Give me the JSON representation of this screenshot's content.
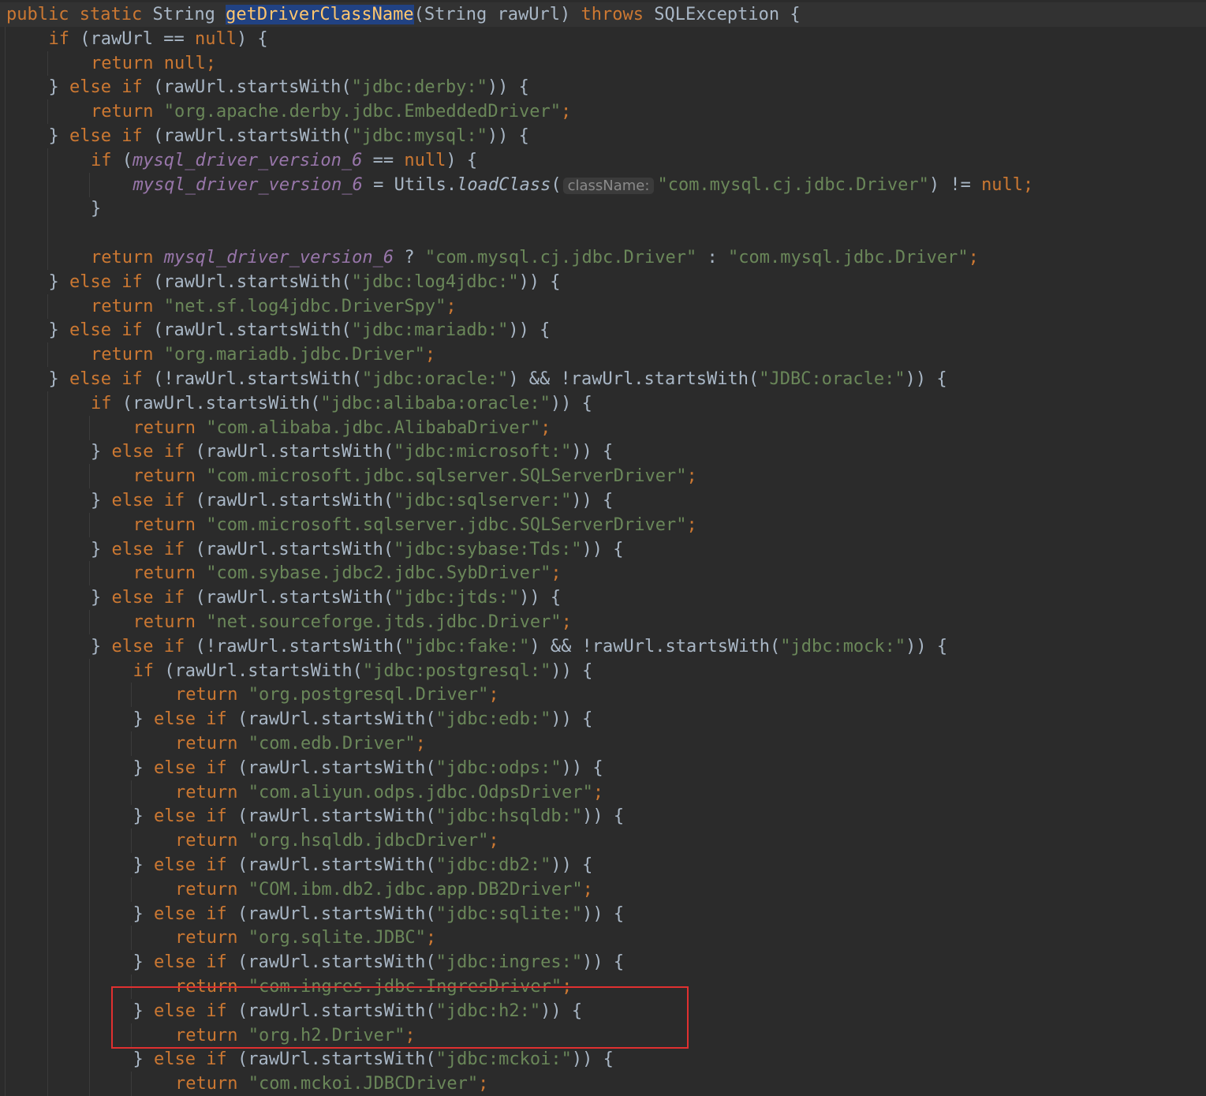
{
  "editor": {
    "method_name": "getDriverClassName",
    "colors": {
      "background": "#2b2b2b",
      "keyword": "#cc7832",
      "string": "#6a8759",
      "field": "#9876aa",
      "selection": "#214283",
      "highlight_box": "#e03030"
    },
    "lines": [
      [
        [
          "kw",
          "public static "
        ],
        [
          "p",
          "String "
        ],
        [
          "sel",
          "getDriverClassName"
        ],
        [
          "p",
          "(String rawUrl) "
        ],
        [
          "kw",
          "throws "
        ],
        [
          "p",
          "SQLException {"
        ]
      ],
      [
        [
          "kw",
          "if "
        ],
        [
          "p",
          "(rawUrl == "
        ],
        [
          "kw",
          "null"
        ],
        [
          "p",
          ") {"
        ]
      ],
      [
        [
          "kw",
          "return null;"
        ]
      ],
      [
        [
          "p",
          "} "
        ],
        [
          "kw",
          "else if "
        ],
        [
          "p",
          "(rawUrl.startsWith("
        ],
        [
          "str",
          "\"jdbc:derby:\""
        ],
        [
          "p",
          ")) {"
        ]
      ],
      [
        [
          "kw",
          "return "
        ],
        [
          "str",
          "\"org.apache.derby.jdbc.EmbeddedDriver\""
        ],
        [
          "kw",
          ";"
        ]
      ],
      [
        [
          "p",
          "} "
        ],
        [
          "kw",
          "else if "
        ],
        [
          "p",
          "(rawUrl.startsWith("
        ],
        [
          "str",
          "\"jdbc:mysql:\""
        ],
        [
          "p",
          ")) {"
        ]
      ],
      [
        [
          "kw",
          "if "
        ],
        [
          "p",
          "("
        ],
        [
          "fld",
          "mysql_driver_version_6"
        ],
        [
          "p",
          " == "
        ],
        [
          "kw",
          "null"
        ],
        [
          "p",
          ") {"
        ]
      ],
      [
        [
          "fld",
          "mysql_driver_version_6"
        ],
        [
          "p",
          " = Utils."
        ],
        [
          "smth",
          "loadClass"
        ],
        [
          "p",
          "("
        ],
        [
          "hint",
          "className:"
        ],
        [
          "str",
          "\"com.mysql.cj.jdbc.Driver\""
        ],
        [
          "p",
          ") != "
        ],
        [
          "kw",
          "null;"
        ]
      ],
      [
        [
          "p",
          "}"
        ]
      ],
      [],
      [
        [
          "kw",
          "return "
        ],
        [
          "fld",
          "mysql_driver_version_6"
        ],
        [
          "p",
          " ? "
        ],
        [
          "str",
          "\"com.mysql.cj.jdbc.Driver\""
        ],
        [
          "p",
          " : "
        ],
        [
          "str",
          "\"com.mysql.jdbc.Driver\""
        ],
        [
          "kw",
          ";"
        ]
      ],
      [
        [
          "p",
          "} "
        ],
        [
          "kw",
          "else if "
        ],
        [
          "p",
          "(rawUrl.startsWith("
        ],
        [
          "str",
          "\"jdbc:log4jdbc:\""
        ],
        [
          "p",
          ")) {"
        ]
      ],
      [
        [
          "kw",
          "return "
        ],
        [
          "str",
          "\"net.sf.log4jdbc.DriverSpy\""
        ],
        [
          "kw",
          ";"
        ]
      ],
      [
        [
          "p",
          "} "
        ],
        [
          "kw",
          "else if "
        ],
        [
          "p",
          "(rawUrl.startsWith("
        ],
        [
          "str",
          "\"jdbc:mariadb:\""
        ],
        [
          "p",
          ")) {"
        ]
      ],
      [
        [
          "kw",
          "return "
        ],
        [
          "str",
          "\"org.mariadb.jdbc.Driver\""
        ],
        [
          "kw",
          ";"
        ]
      ],
      [
        [
          "p",
          "} "
        ],
        [
          "kw",
          "else if "
        ],
        [
          "p",
          "(!rawUrl.startsWith("
        ],
        [
          "str",
          "\"jdbc:oracle:\""
        ],
        [
          "p",
          ") && !rawUrl.startsWith("
        ],
        [
          "str",
          "\"JDBC:oracle:\""
        ],
        [
          "p",
          ")) {"
        ]
      ],
      [
        [
          "kw",
          "if "
        ],
        [
          "p",
          "(rawUrl.startsWith("
        ],
        [
          "str",
          "\"jdbc:alibaba:oracle:\""
        ],
        [
          "p",
          ")) {"
        ]
      ],
      [
        [
          "kw",
          "return "
        ],
        [
          "str",
          "\"com.alibaba.jdbc.AlibabaDriver\""
        ],
        [
          "kw",
          ";"
        ]
      ],
      [
        [
          "p",
          "} "
        ],
        [
          "kw",
          "else if "
        ],
        [
          "p",
          "(rawUrl.startsWith("
        ],
        [
          "str",
          "\"jdbc:microsoft:\""
        ],
        [
          "p",
          ")) {"
        ]
      ],
      [
        [
          "kw",
          "return "
        ],
        [
          "str",
          "\"com.microsoft.jdbc.sqlserver.SQLServerDriver\""
        ],
        [
          "kw",
          ";"
        ]
      ],
      [
        [
          "p",
          "} "
        ],
        [
          "kw",
          "else if "
        ],
        [
          "p",
          "(rawUrl.startsWith("
        ],
        [
          "str",
          "\"jdbc:sqlserver:\""
        ],
        [
          "p",
          ")) {"
        ]
      ],
      [
        [
          "kw",
          "return "
        ],
        [
          "str",
          "\"com.microsoft.sqlserver.jdbc.SQLServerDriver\""
        ],
        [
          "kw",
          ";"
        ]
      ],
      [
        [
          "p",
          "} "
        ],
        [
          "kw",
          "else if "
        ],
        [
          "p",
          "(rawUrl.startsWith("
        ],
        [
          "str",
          "\"jdbc:sybase:Tds:\""
        ],
        [
          "p",
          ")) {"
        ]
      ],
      [
        [
          "kw",
          "return "
        ],
        [
          "str",
          "\"com.sybase.jdbc2.jdbc.SybDriver\""
        ],
        [
          "kw",
          ";"
        ]
      ],
      [
        [
          "p",
          "} "
        ],
        [
          "kw",
          "else if "
        ],
        [
          "p",
          "(rawUrl.startsWith("
        ],
        [
          "str",
          "\"jdbc:jtds:\""
        ],
        [
          "p",
          ")) {"
        ]
      ],
      [
        [
          "kw",
          "return "
        ],
        [
          "str",
          "\"net.sourceforge.jtds.jdbc.Driver\""
        ],
        [
          "kw",
          ";"
        ]
      ],
      [
        [
          "p",
          "} "
        ],
        [
          "kw",
          "else if "
        ],
        [
          "p",
          "(!rawUrl.startsWith("
        ],
        [
          "str",
          "\"jdbc:fake:\""
        ],
        [
          "p",
          ") && !rawUrl.startsWith("
        ],
        [
          "str",
          "\"jdbc:mock:\""
        ],
        [
          "p",
          ")) {"
        ]
      ],
      [
        [
          "kw",
          "if "
        ],
        [
          "p",
          "(rawUrl.startsWith("
        ],
        [
          "str",
          "\"jdbc:postgresql:\""
        ],
        [
          "p",
          ")) {"
        ]
      ],
      [
        [
          "kw",
          "return "
        ],
        [
          "str",
          "\"org.postgresql.Driver\""
        ],
        [
          "kw",
          ";"
        ]
      ],
      [
        [
          "p",
          "} "
        ],
        [
          "kw",
          "else if "
        ],
        [
          "p",
          "(rawUrl.startsWith("
        ],
        [
          "str",
          "\"jdbc:edb:\""
        ],
        [
          "p",
          ")) {"
        ]
      ],
      [
        [
          "kw",
          "return "
        ],
        [
          "str",
          "\"com.edb.Driver\""
        ],
        [
          "kw",
          ";"
        ]
      ],
      [
        [
          "p",
          "} "
        ],
        [
          "kw",
          "else if "
        ],
        [
          "p",
          "(rawUrl.startsWith("
        ],
        [
          "str",
          "\"jdbc:odps:\""
        ],
        [
          "p",
          ")) {"
        ]
      ],
      [
        [
          "kw",
          "return "
        ],
        [
          "str",
          "\"com.aliyun.odps.jdbc.OdpsDriver\""
        ],
        [
          "kw",
          ";"
        ]
      ],
      [
        [
          "p",
          "} "
        ],
        [
          "kw",
          "else if "
        ],
        [
          "p",
          "(rawUrl.startsWith("
        ],
        [
          "str",
          "\"jdbc:hsqldb:\""
        ],
        [
          "p",
          ")) {"
        ]
      ],
      [
        [
          "kw",
          "return "
        ],
        [
          "str",
          "\"org.hsqldb.jdbcDriver\""
        ],
        [
          "kw",
          ";"
        ]
      ],
      [
        [
          "p",
          "} "
        ],
        [
          "kw",
          "else if "
        ],
        [
          "p",
          "(rawUrl.startsWith("
        ],
        [
          "str",
          "\"jdbc:db2:\""
        ],
        [
          "p",
          ")) {"
        ]
      ],
      [
        [
          "kw",
          "return "
        ],
        [
          "str",
          "\"COM.ibm.db2.jdbc.app.DB2Driver\""
        ],
        [
          "kw",
          ";"
        ]
      ],
      [
        [
          "p",
          "} "
        ],
        [
          "kw",
          "else if "
        ],
        [
          "p",
          "(rawUrl.startsWith("
        ],
        [
          "str",
          "\"jdbc:sqlite:\""
        ],
        [
          "p",
          ")) {"
        ]
      ],
      [
        [
          "kw",
          "return "
        ],
        [
          "str",
          "\"org.sqlite.JDBC\""
        ],
        [
          "kw",
          ";"
        ]
      ],
      [
        [
          "p",
          "} "
        ],
        [
          "kw",
          "else if "
        ],
        [
          "p",
          "(rawUrl.startsWith("
        ],
        [
          "str",
          "\"jdbc:ingres:\""
        ],
        [
          "p",
          ")) {"
        ]
      ],
      [
        [
          "kw",
          "return "
        ],
        [
          "str",
          "\"com.ingres.jdbc.IngresDriver\""
        ],
        [
          "kw",
          ";"
        ]
      ],
      [
        [
          "p",
          "} "
        ],
        [
          "kw",
          "else if "
        ],
        [
          "p",
          "(rawUrl.startsWith("
        ],
        [
          "str",
          "\"jdbc:h2:\""
        ],
        [
          "p",
          ")) {"
        ]
      ],
      [
        [
          "kw",
          "return "
        ],
        [
          "str",
          "\"org.h2.Driver\""
        ],
        [
          "kw",
          ";"
        ]
      ],
      [
        [
          "p",
          "} "
        ],
        [
          "kw",
          "else if "
        ],
        [
          "p",
          "(rawUrl.startsWith("
        ],
        [
          "str",
          "\"jdbc:mckoi:\""
        ],
        [
          "p",
          ")) {"
        ]
      ],
      [
        [
          "kw",
          "return "
        ],
        [
          "str",
          "\"com.mckoi.JDBCDriver\""
        ],
        [
          "kw",
          ";"
        ]
      ]
    ]
  }
}
